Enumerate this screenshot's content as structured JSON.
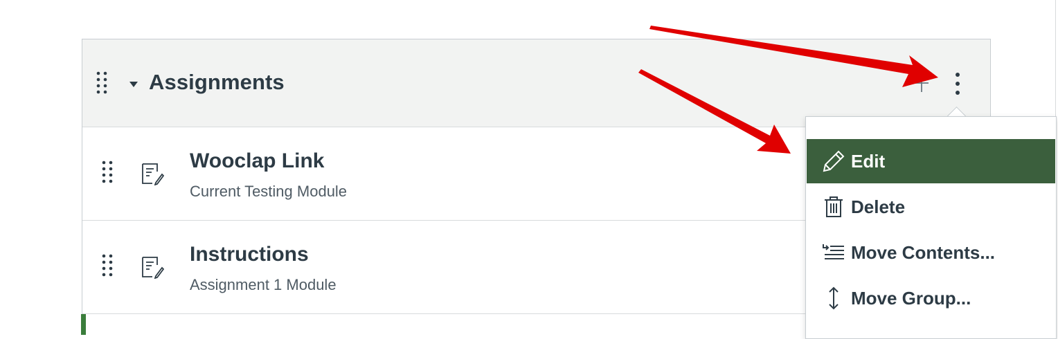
{
  "group": {
    "title": "Assignments"
  },
  "items": [
    {
      "title": "Wooclap Link",
      "subtitle": "Current Testing Module"
    },
    {
      "title": "Instructions",
      "subtitle": "Assignment 1 Module"
    }
  ],
  "menu": {
    "items": [
      {
        "label": "Edit",
        "icon": "pencil-icon",
        "active": true
      },
      {
        "label": "Delete",
        "icon": "trash-icon",
        "active": false
      },
      {
        "label": "Move Contents...",
        "icon": "move-contents-icon",
        "active": false
      },
      {
        "label": "Move Group...",
        "icon": "vertical-arrows-icon",
        "active": false
      }
    ]
  },
  "colors": {
    "menu_active_bg": "#3b5f3d",
    "accent_green": "#3a7d3b",
    "annotation_arrow": "#e00000",
    "header_bg": "#f2f3f2"
  }
}
